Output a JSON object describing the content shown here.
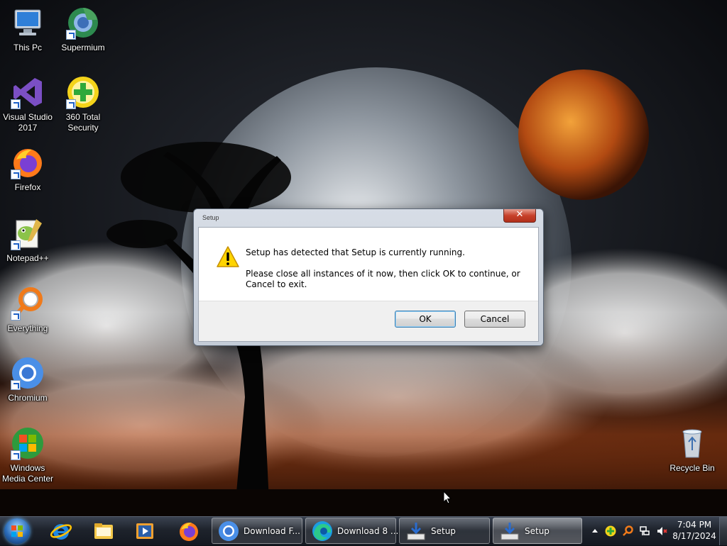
{
  "desktop": {
    "icons": [
      {
        "label": "This Pc",
        "icon": "computer-icon"
      },
      {
        "label": "Supermium",
        "icon": "supermium-icon"
      },
      {
        "label": "Visual Studio 2017",
        "icon": "visual-studio-icon"
      },
      {
        "label": "360 Total Security",
        "icon": "360-total-security-icon"
      },
      {
        "label": "Firefox",
        "icon": "firefox-icon"
      },
      {
        "label": "Notepad++",
        "icon": "notepadplusplus-icon"
      },
      {
        "label": "Everything",
        "icon": "everything-search-icon"
      },
      {
        "label": "Chromium",
        "icon": "chromium-icon"
      },
      {
        "label": "Windows Media Center",
        "icon": "windows-media-center-icon"
      },
      {
        "label": "Recycle Bin",
        "icon": "recycle-bin-icon"
      }
    ]
  },
  "dialog": {
    "title": "Setup",
    "close_glyph": "✕",
    "message_primary": "Setup has detected that Setup is currently running.",
    "message_secondary": "Please close all instances of it now, then click OK to continue, or Cancel to exit.",
    "icon": "warning-icon",
    "ok_label": "OK",
    "cancel_label": "Cancel"
  },
  "taskbar": {
    "pinned": [
      "internet-explorer-icon",
      "file-explorer-icon",
      "media-player-icon",
      "firefox-icon"
    ],
    "tasks": [
      {
        "label": "Download F...",
        "icon": "chromium-icon"
      },
      {
        "label": "Download 8 ...",
        "icon": "edge-icon"
      },
      {
        "label": "Setup",
        "icon": "setup-installer-icon"
      },
      {
        "label": "Setup",
        "icon": "setup-installer-icon"
      }
    ],
    "tray": {
      "time": "7:04 PM",
      "date": "8/17/2024"
    }
  },
  "colors": {
    "taskbar": "#1e232c",
    "dialog_frame": "#c4ccd7",
    "close_button": "#c7412a",
    "default_button_border": "#3c7fb1"
  }
}
